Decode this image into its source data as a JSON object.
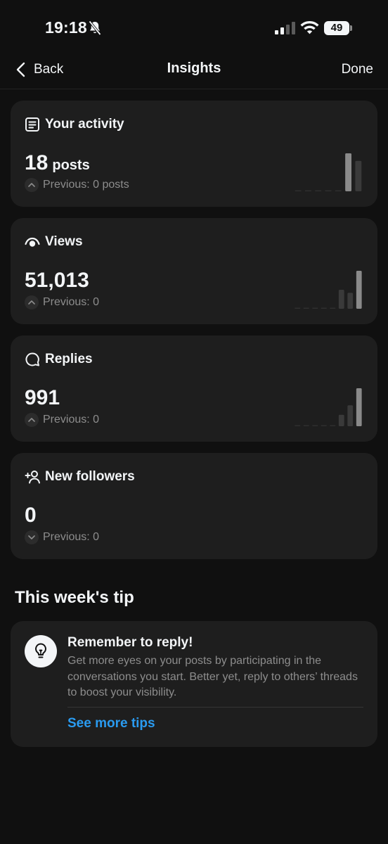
{
  "status_bar": {
    "time": "19:18",
    "battery_level": "49",
    "icons": [
      "bell-slash-icon",
      "cellular-signal-icon",
      "wifi-icon",
      "battery-icon"
    ]
  },
  "nav": {
    "back_label": "Back",
    "title": "Insights",
    "done_label": "Done"
  },
  "cards": [
    {
      "title": "Your activity",
      "icon": "document-list-icon",
      "value": "18",
      "unit": "posts",
      "previous": "Previous: 0 posts",
      "trend": "up",
      "bars": [
        0,
        0,
        0,
        0,
        0,
        1.0,
        0.8
      ]
    },
    {
      "title": "Views",
      "icon": "eye-icon",
      "value": "51,013",
      "unit": "",
      "previous": "Previous: 0",
      "trend": "up",
      "bars": [
        0,
        0,
        0,
        0,
        0,
        0.5,
        0.42,
        1.0
      ]
    },
    {
      "title": "Replies",
      "icon": "speech-bubble-icon",
      "value": "991",
      "unit": "",
      "previous": "Previous: 0",
      "trend": "up",
      "bars": [
        0,
        0,
        0,
        0,
        0,
        0.3,
        0.55,
        1.0
      ]
    },
    {
      "title": "New followers",
      "icon": "add-person-icon",
      "value": "0",
      "unit": "",
      "previous": "Previous: 0",
      "trend": "down",
      "bars": []
    }
  ],
  "tip_section": {
    "title": "This week's tip",
    "icon": "lightbulb-icon",
    "tip_title": "Remember to reply!",
    "tip_body": "Get more eyes on your posts by participating in the conversations you start. Better yet, reply to others’ threads to boost your visibility.",
    "link_label": "See more tips"
  },
  "colors": {
    "background": "#101010",
    "card": "#1e1e1e",
    "text_primary": "#f3f5f7",
    "text_secondary": "#8d8d8d",
    "link": "#2a9bf0",
    "bar_highlight": "#8a8a8a",
    "bar_muted": "#2f2f2f"
  }
}
